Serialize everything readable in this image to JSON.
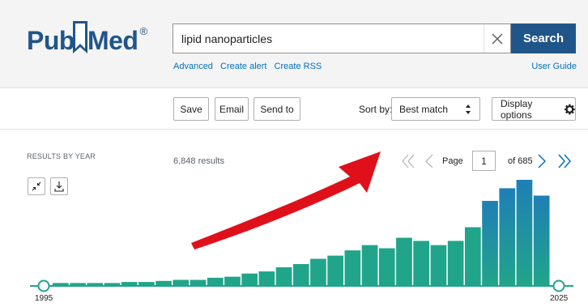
{
  "header": {
    "logo_pub": "Pub",
    "logo_med": "Med",
    "logo_reg": "®",
    "search_value": "lipid nanoparticles",
    "search_button": "Search",
    "links": [
      "Advanced",
      "Create alert",
      "Create RSS"
    ],
    "user_guide": "User Guide"
  },
  "toolbar": {
    "save": "Save",
    "email": "Email",
    "send_to": "Send to",
    "sort_label": "Sort by:",
    "sort_value": "Best match",
    "display_options": "Display options"
  },
  "results": {
    "by_year_label": "RESULTS BY YEAR",
    "count": "6,848 results",
    "page_label": "Page",
    "page_value": "1",
    "page_of": "of 685"
  },
  "colors": {
    "brand": "#20558a",
    "bar": "#20a58a",
    "bar_top": "#1f7fb5",
    "arrow": "#e0101a"
  },
  "chart_data": {
    "type": "bar",
    "start_year": "1995",
    "end_year": "2025",
    "values": [
      2,
      2,
      2,
      2,
      3,
      3,
      4,
      5,
      5,
      7,
      8,
      11,
      13,
      17,
      20,
      25,
      28,
      33,
      38,
      35,
      45,
      42,
      38,
      42,
      55,
      80,
      92,
      100,
      85
    ],
    "ymax": 100,
    "highlight_from": 25
  }
}
